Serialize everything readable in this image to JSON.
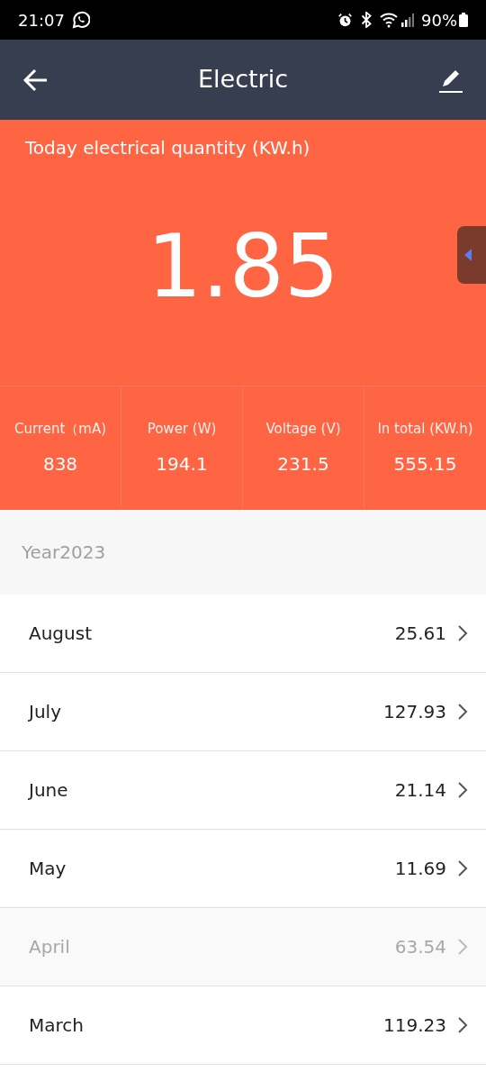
{
  "status_bar": {
    "time": "21:07",
    "battery": "90%"
  },
  "header": {
    "title": "Electric"
  },
  "today": {
    "label": "Today electrical quantity (KW.h)",
    "value": "1.85"
  },
  "stats": [
    {
      "label": "Current（mA)",
      "value": "838"
    },
    {
      "label": "Power (W)",
      "value": "194.1"
    },
    {
      "label": "Voltage (V)",
      "value": "231.5"
    },
    {
      "label": "In total (KW.h)",
      "value": "555.15"
    }
  ],
  "year": "Year2023",
  "months": [
    {
      "name": "August",
      "value": "25.61",
      "dimmed": false
    },
    {
      "name": "July",
      "value": "127.93",
      "dimmed": false
    },
    {
      "name": "June",
      "value": "21.14",
      "dimmed": false
    },
    {
      "name": "May",
      "value": "11.69",
      "dimmed": false
    },
    {
      "name": "April",
      "value": "63.54",
      "dimmed": true
    },
    {
      "name": "March",
      "value": "119.23",
      "dimmed": false
    }
  ]
}
